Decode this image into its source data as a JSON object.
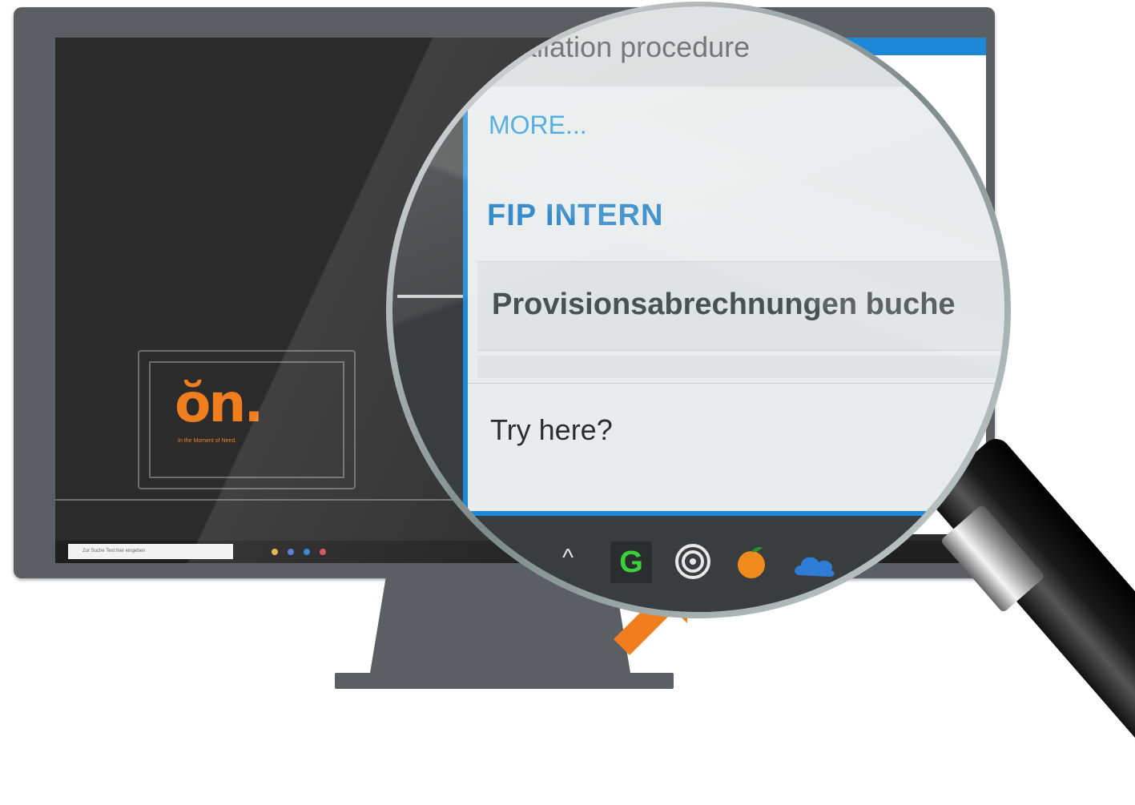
{
  "wallpaper": {
    "logo_text": "ŏn.",
    "tagline": "In the Moment of Need."
  },
  "taskbar": {
    "search_placeholder": "Zur Suche Text hier eingeben"
  },
  "magnified": {
    "window_title_partial": "tallation procedure",
    "more_link": "MORE...",
    "section_title": "FIP INTERN",
    "item_label": "Provisionsabrechnungen buche",
    "try_link": "Try here?",
    "tray": {
      "chevron": "^",
      "g_app_label": "G"
    }
  },
  "colors": {
    "accent_blue": "#1e88d8",
    "brand_orange": "#f07d1e"
  },
  "icons": [
    "chevron-up-icon",
    "g-app-icon",
    "spiral-app-icon",
    "orange-app-icon",
    "onedrive-cloud-icon",
    "arrow-pointer-icon",
    "magnifier-icon"
  ]
}
